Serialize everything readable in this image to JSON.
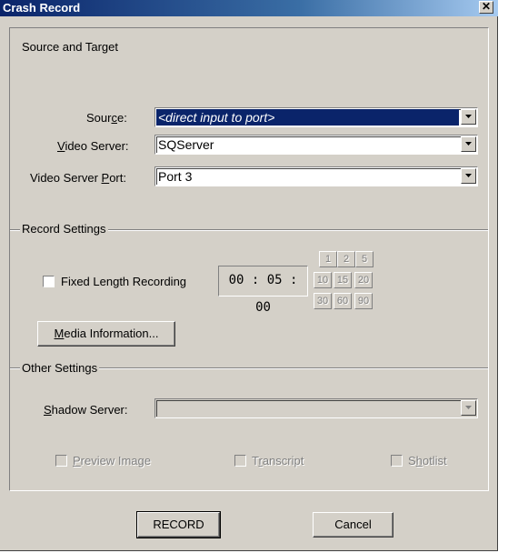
{
  "window": {
    "title": "Crash Record",
    "close_glyph": "✕"
  },
  "source_target": {
    "group_label": "Source and Target",
    "source": {
      "label_pre": "Sour",
      "label_key": "c",
      "label_post": "e:",
      "value": "<direct input to port>"
    },
    "video_server": {
      "label_pre": "",
      "label_key": "V",
      "label_post": "ideo Server:",
      "value": "SQServer"
    },
    "video_server_port": {
      "label_pre": "Video Server ",
      "label_key": "P",
      "label_post": "ort:",
      "value": "Port 3"
    }
  },
  "record_settings": {
    "group_label": "Record Settings",
    "fixed_length": {
      "label": "Fixed Length Recording",
      "checked": false
    },
    "time_value": "00 : 05 : 00",
    "quick_buttons": [
      "1",
      "2",
      "5",
      "10",
      "15",
      "20",
      "30",
      "60",
      "90"
    ],
    "media_info_button": {
      "key": "M",
      "rest": "edia Information..."
    }
  },
  "other_settings": {
    "group_label": "Other Settings",
    "shadow_server": {
      "label_key": "S",
      "label_rest": "hadow Server:",
      "value": ""
    },
    "preview_image": {
      "key": "P",
      "rest": "review Image",
      "checked": false
    },
    "transcript": {
      "pre": "T",
      "key": "r",
      "rest": "anscript",
      "checked": false
    },
    "shotlist": {
      "pre": "S",
      "key": "h",
      "rest": "otlist",
      "checked": false
    }
  },
  "footer": {
    "record_label": "RECORD",
    "cancel_label": "Cancel"
  },
  "icons": {
    "dropdown": "chevron-down-icon",
    "close": "close-icon"
  },
  "colors": {
    "title_start": "#0a246a",
    "title_end": "#a6caf0",
    "face": "#d4d0c8",
    "selection": "#0a246a"
  }
}
